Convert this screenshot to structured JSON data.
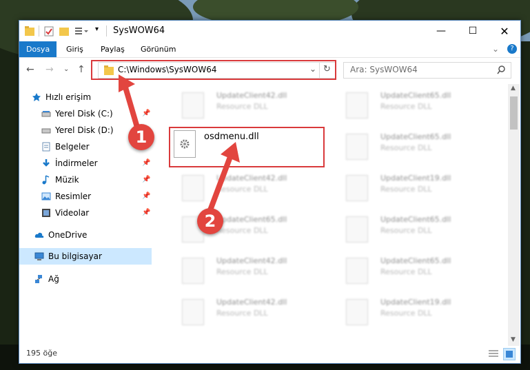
{
  "window": {
    "title": "SysWOW64"
  },
  "ribbon": {
    "tabs": [
      "Dosya",
      "Giriş",
      "Paylaş",
      "Görünüm"
    ]
  },
  "address": {
    "path": "C:\\Windows\\SysWOW64"
  },
  "search": {
    "placeholder": "Ara: SysWOW64"
  },
  "sidebar": {
    "items": [
      {
        "label": "Hızlı erişim",
        "icon": "star-icon"
      },
      {
        "label": "Yerel Disk (C:)",
        "icon": "drive-icon",
        "pinned": true
      },
      {
        "label": "Yerel Disk (D:)",
        "icon": "drive-icon"
      },
      {
        "label": "Belgeler",
        "icon": "document-icon"
      },
      {
        "label": "İndirmeler",
        "icon": "download-icon",
        "pinned": true
      },
      {
        "label": "Müzik",
        "icon": "music-icon",
        "pinned": true
      },
      {
        "label": "Resimler",
        "icon": "picture-icon",
        "pinned": true
      },
      {
        "label": "Videolar",
        "icon": "video-icon",
        "pinned": true
      },
      {
        "label": "OneDrive",
        "icon": "cloud-icon"
      },
      {
        "label": "Bu bilgisayar",
        "icon": "computer-icon",
        "selected": true
      },
      {
        "label": "Ağ",
        "icon": "network-icon"
      }
    ]
  },
  "files": {
    "highlighted": {
      "name": "osdmenu.dll"
    },
    "tiles": [
      {
        "name": "UpdateClient42.dll",
        "type": "Resource DLL"
      },
      {
        "name": "UpdateClient65.dll",
        "type": "Resource DLL"
      },
      {
        "name": "UpdateClient65.dll",
        "type": "Resource DLL"
      },
      {
        "name": "UpdateClient42.dll",
        "type": "Resource DLL"
      },
      {
        "name": "UpdateClient19.dll",
        "type": "Resource DLL"
      },
      {
        "name": "UpdateClient65.dll",
        "type": "Resource DLL"
      },
      {
        "name": "UpdateClient65.dll",
        "type": "Resource DLL"
      },
      {
        "name": "UpdateClient42.dll",
        "type": "Resource DLL"
      },
      {
        "name": "UpdateClient65.dll",
        "type": "Resource DLL"
      },
      {
        "name": "UpdateClient42.dll",
        "type": "Resource DLL"
      },
      {
        "name": "UpdateClient19.dll",
        "type": "Resource DLL"
      }
    ]
  },
  "status": {
    "count": "195 öğe"
  },
  "annotations": {
    "step1": "1",
    "step2": "2",
    "color": "#e2453f"
  }
}
